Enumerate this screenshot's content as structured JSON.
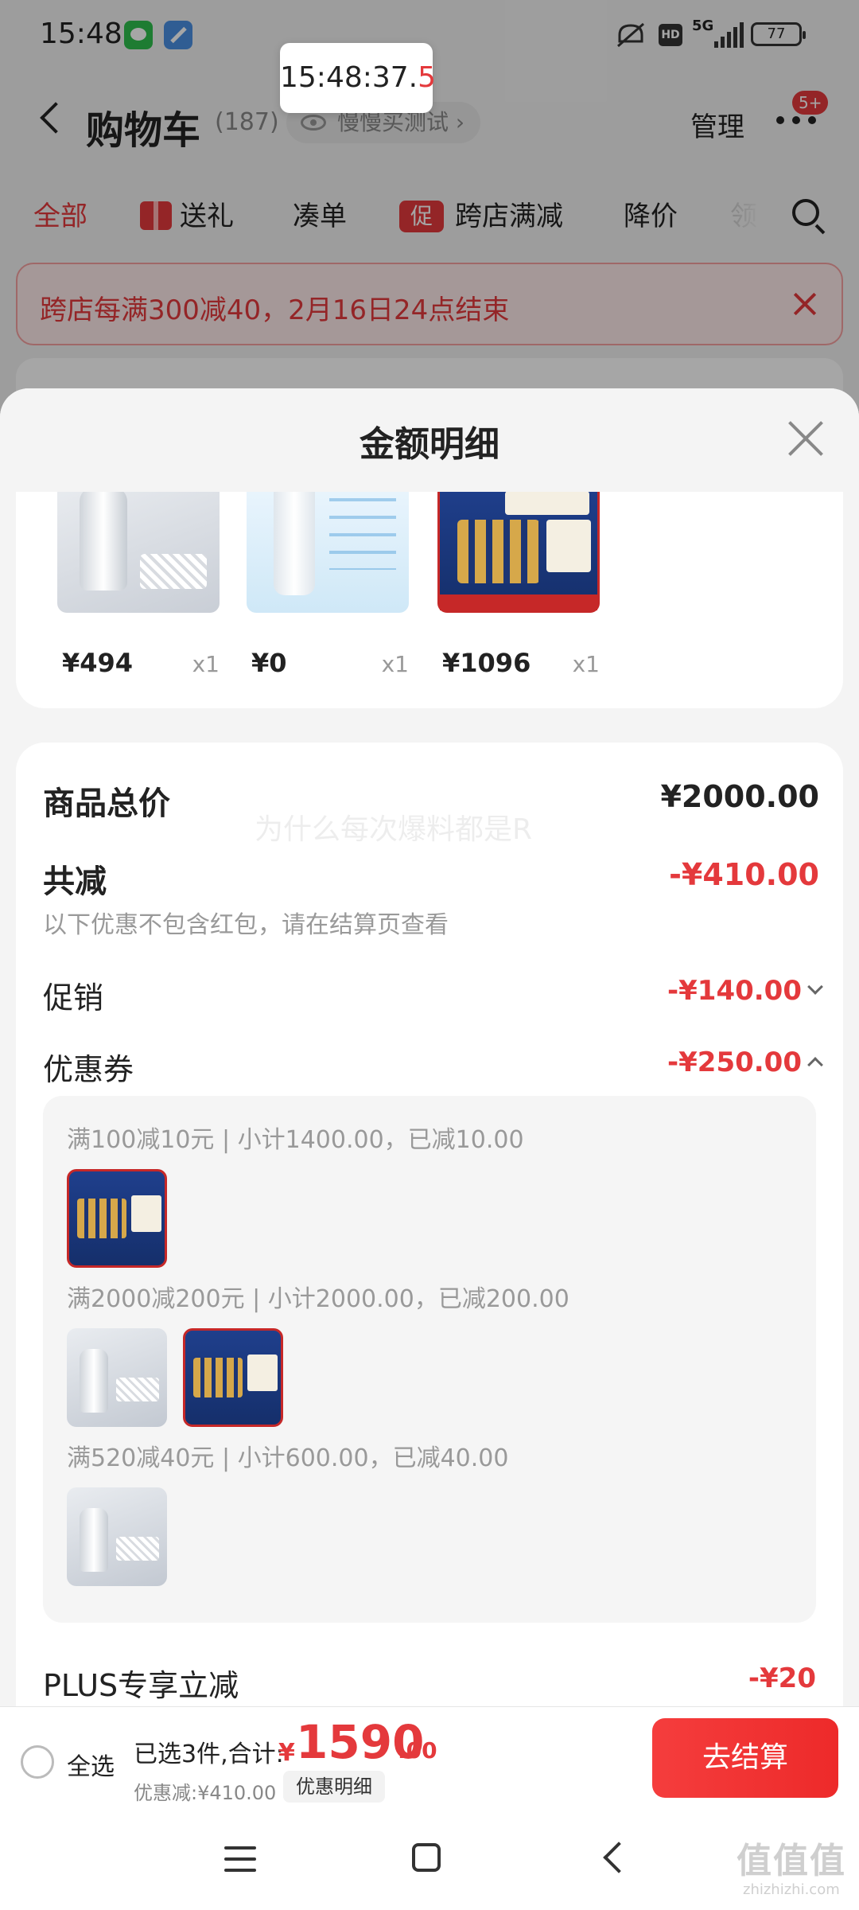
{
  "status_bar": {
    "time": "15:48",
    "network": "5G",
    "hd": "HD",
    "battery": "77"
  },
  "time_popup": {
    "main": "15:48:37.",
    "highlight": "5"
  },
  "header": {
    "title": "购物车",
    "count": "(187)",
    "test_label": "慢慢买测试 ›",
    "manage": "管理",
    "badge": "5+"
  },
  "tabs": [
    {
      "label": "全部"
    },
    {
      "label": "送礼"
    },
    {
      "label": "凑单"
    },
    {
      "label": "跨店满减",
      "badge": "促"
    },
    {
      "label": "降价"
    },
    {
      "label": "领"
    }
  ],
  "promo_banner": {
    "text": "跨店每满300减40，2月16日24点结束"
  },
  "sheet": {
    "title": "金额明细",
    "products": [
      {
        "price": "¥494",
        "qty": "x1"
      },
      {
        "price": "¥0",
        "qty": "x1"
      },
      {
        "price": "¥1096",
        "qty": "x1"
      }
    ],
    "watermark": "为什么每次爆料都是R",
    "rows": {
      "total_label": "商品总价",
      "total_value": "¥2000.00",
      "reduce_label": "共减",
      "reduce_value": "-¥410.00",
      "reduce_note": "以下优惠不包含红包，请在结算页查看",
      "promo_label": "促销",
      "promo_value": "-¥140.00",
      "coupon_label": "优惠券",
      "coupon_value": "-¥250.00",
      "plus_label": "PLUS专享立减",
      "plus_value": "-¥20"
    },
    "coupons": [
      {
        "text": "满100减10元 | 小计1400.00，已减10.00"
      },
      {
        "text": "满2000减200元 | 小计2000.00，已减200.00"
      },
      {
        "text": "满520减40元 | 小计600.00，已减40.00"
      }
    ]
  },
  "checkout": {
    "select_all": "全选",
    "total_prefix": "已选3件,合计:",
    "yen": "¥",
    "total_int": "1590",
    "total_dec": ".00",
    "discount": "优惠减:¥410.00",
    "detail_btn": "优惠明细",
    "checkout_btn": "去结算"
  },
  "watermark_site": {
    "logo": "值值值",
    "url": "zhizhizhi.com"
  },
  "colors": {
    "accent": "#e4393c",
    "checkout": "#f53d3d"
  }
}
